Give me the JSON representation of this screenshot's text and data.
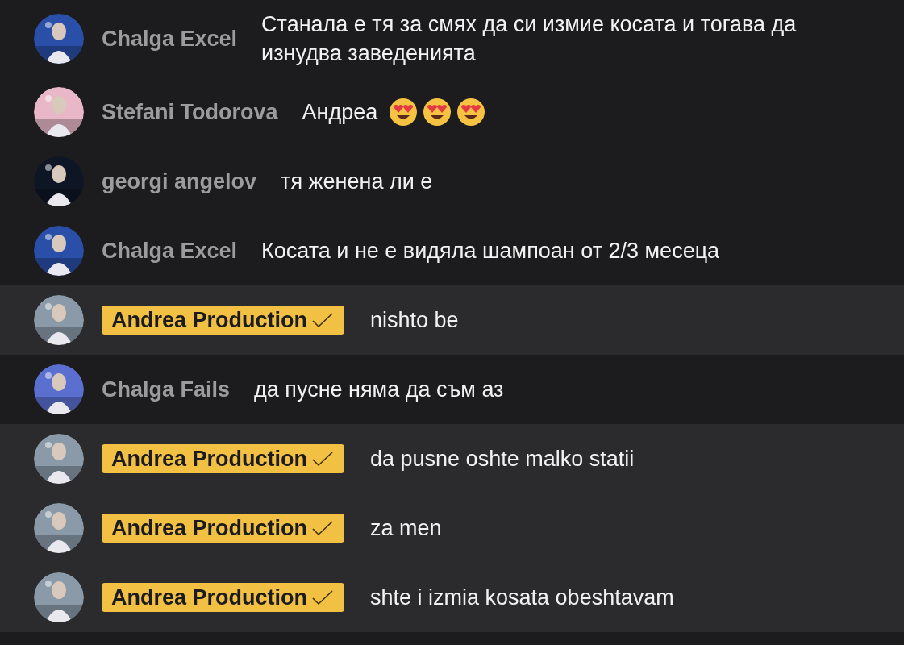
{
  "comments": [
    {
      "kind": "viewer",
      "highlighted": false,
      "color": "#2a4fa8",
      "name": "Chalga Excel",
      "message": "Станала е тя за смях да си измие косата и тогава да изнудва заведенията"
    },
    {
      "kind": "viewer",
      "highlighted": false,
      "color": "#e8b8c8",
      "name": "Stefani Todorova",
      "message": "Андреа",
      "reactions": [
        {
          "kind": "heart-eyes"
        },
        {
          "kind": "heart-eyes"
        },
        {
          "kind": "heart-eyes"
        }
      ]
    },
    {
      "kind": "viewer",
      "highlighted": false,
      "color": "#0e1626",
      "name": "georgi angelov",
      "message": "тя женена ли е"
    },
    {
      "kind": "viewer",
      "highlighted": false,
      "color": "#2a4fa8",
      "name": "Chalga Excel",
      "message": "Косата и не е видяла шампоан от 2/3 месеца"
    },
    {
      "kind": "host",
      "highlighted": true,
      "color": "#8a9aa8",
      "name": "Andrea Production",
      "message": "nishto be"
    },
    {
      "kind": "viewer",
      "highlighted": false,
      "color": "#5a6fd0",
      "name": "Chalga Fails",
      "message": "да пусне няма да съм аз"
    },
    {
      "kind": "host",
      "highlighted": true,
      "color": "#8a9aa8",
      "name": "Andrea Production",
      "message": "da pusne oshte malko statii"
    },
    {
      "kind": "host",
      "highlighted": true,
      "color": "#8a9aa8",
      "name": "Andrea Production",
      "message": "za men"
    },
    {
      "kind": "host",
      "highlighted": true,
      "color": "#8a9aa8",
      "name": "Andrea Production",
      "message": "shte i izmia kosata obeshtavam"
    }
  ]
}
